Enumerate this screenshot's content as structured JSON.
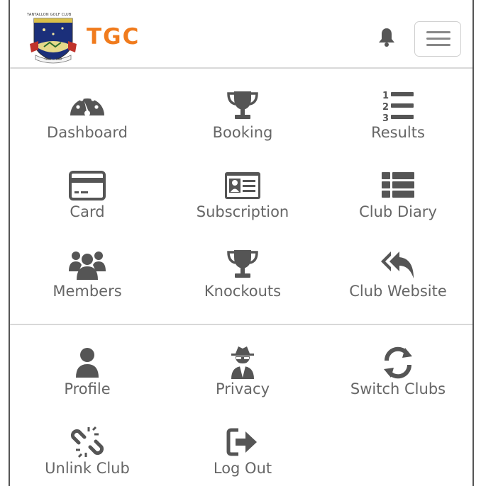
{
  "header": {
    "club_caption": "TANTALLON GOLF CLUB",
    "brand": "TGC",
    "logo_motto": "FIRM ... FAIR"
  },
  "colors": {
    "brand": "#f07b1d",
    "icon": "#555555",
    "label": "#666666",
    "divider": "#d8d8d8"
  },
  "menu": {
    "main": [
      {
        "label": "Dashboard",
        "icon": "gauge-icon"
      },
      {
        "label": "Booking",
        "icon": "trophy-icon"
      },
      {
        "label": "Results",
        "icon": "numbered-list-icon"
      },
      {
        "label": "Card",
        "icon": "credit-card-icon"
      },
      {
        "label": "Subscription",
        "icon": "id-card-icon"
      },
      {
        "label": "Club Diary",
        "icon": "list-icon"
      },
      {
        "label": "Members",
        "icon": "users-icon"
      },
      {
        "label": "Knockouts",
        "icon": "trophy-icon"
      },
      {
        "label": "Club Website",
        "icon": "reply-all-icon"
      }
    ],
    "account": [
      {
        "label": "Profile",
        "icon": "user-icon"
      },
      {
        "label": "Privacy",
        "icon": "user-secret-icon"
      },
      {
        "label": "Switch Clubs",
        "icon": "refresh-icon"
      },
      {
        "label": "Unlink Club",
        "icon": "unlink-icon"
      },
      {
        "label": "Log Out",
        "icon": "sign-out-icon"
      }
    ]
  }
}
